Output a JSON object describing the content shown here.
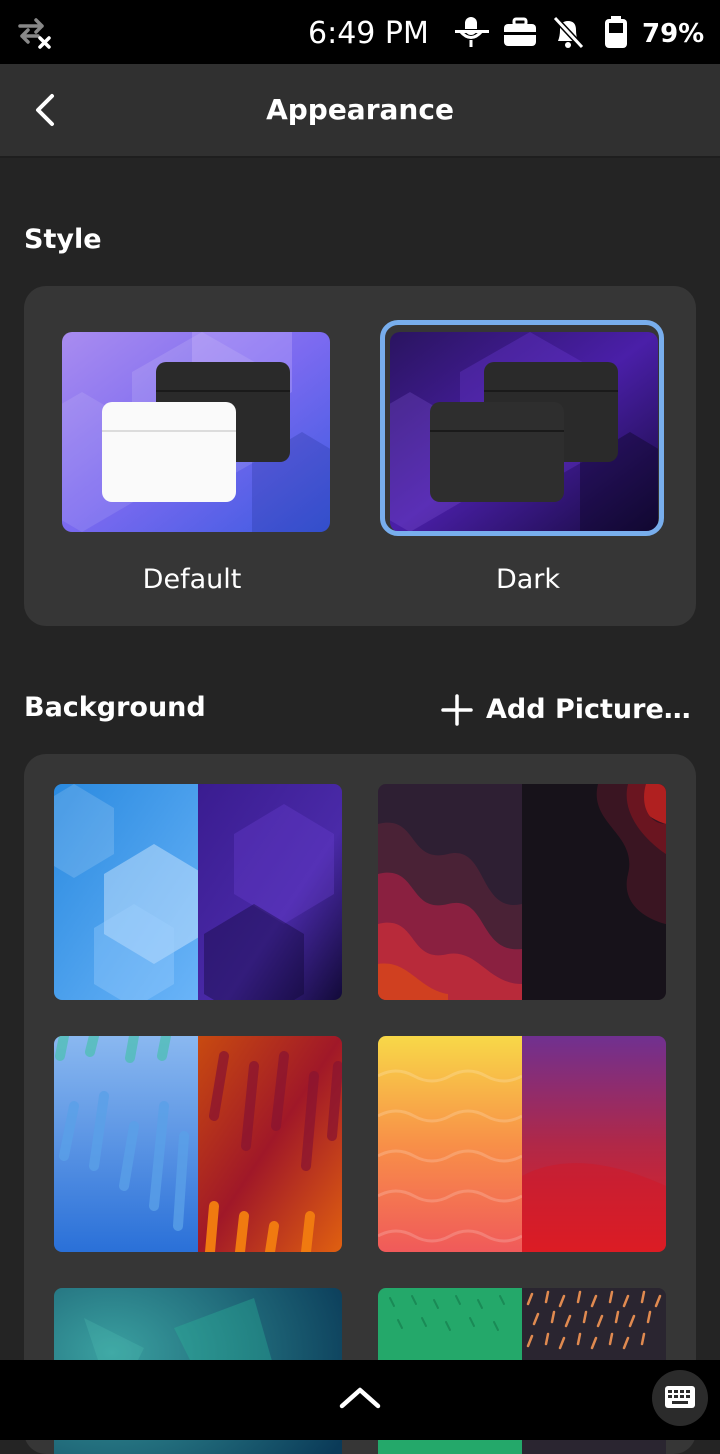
{
  "status_bar": {
    "time": "6:49 PM",
    "battery_percent": "79%",
    "icons": [
      "network-offline-icon",
      "microphone-muted-icon",
      "case-icon",
      "notifications-muted-icon",
      "battery-icon"
    ]
  },
  "header": {
    "title": "Appearance"
  },
  "style_section": {
    "title": "Style",
    "options": [
      {
        "label": "Default",
        "selected": false
      },
      {
        "label": "Dark",
        "selected": true
      }
    ]
  },
  "background_section": {
    "title": "Background",
    "add_picture_label": "Add Picture…"
  },
  "wallpapers": [
    {
      "name": "blobs"
    },
    {
      "name": "waves"
    },
    {
      "name": "drool"
    },
    {
      "name": "fold"
    },
    {
      "name": "glass"
    },
    {
      "name": "dots"
    }
  ],
  "colors": {
    "accent": "#78aeed",
    "window_bg": "#242424",
    "card_bg": "#363636"
  }
}
